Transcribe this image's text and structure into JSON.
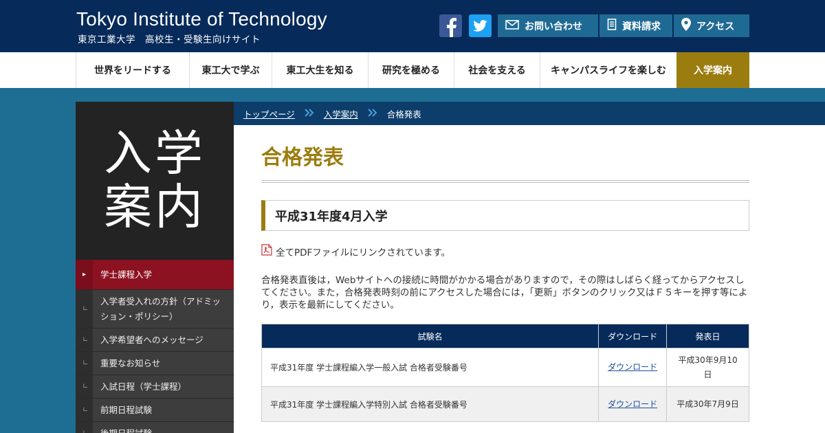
{
  "header": {
    "logo_en": "Tokyo Institute of Technology",
    "logo_ja": "東京工業大学　高校生・受験生向けサイト",
    "buttons": {
      "contact": "お問い合わせ",
      "docs": "資料請求",
      "access": "アクセス"
    },
    "sns": [
      "facebook-icon",
      "twitter-icon"
    ]
  },
  "nav": {
    "items": [
      "世界をリードする",
      "東工大で学ぶ",
      "東工大生を知る",
      "研究を極める",
      "社会を支える",
      "キャンパスライフを楽しむ",
      "入学案内"
    ],
    "active": "入学案内"
  },
  "side": {
    "hero": [
      "入学",
      "案内"
    ],
    "menu": [
      {
        "label": "学士課程入学",
        "current": true
      },
      {
        "label": "入学者受入れの方針（アドミッション・ポリシー）",
        "current": false
      },
      {
        "label": "入学希望者へのメッセージ",
        "current": false
      },
      {
        "label": "重要なお知らせ",
        "current": false
      },
      {
        "label": "入試日程（学士課程）",
        "current": false
      },
      {
        "label": "前期日程試験",
        "current": false
      },
      {
        "label": "後期日程試験",
        "current": false
      }
    ]
  },
  "breadcrumb": [
    "トップページ",
    "入学案内",
    "合格発表"
  ],
  "main": {
    "title": "合格発表",
    "section_title": "平成31年度4月入学",
    "pdf_note": "全てPDFファイルにリンクされています。",
    "paragraph": "合格発表直後は，Webサイトへの接続に時間がかかる場合がありますので，その際はしばらく経ってからアクセスしてください。また，合格発表時刻の前にアクセスした場合には，「更新」ボタンのクリック又はＦ５キーを押す等により，表示を最新にしてください。",
    "table": {
      "headers": [
        "試験名",
        "ダウンロード",
        "発表日"
      ],
      "rows": [
        [
          "平成31年度 学士課程編入学一般入試 合格者受験番号",
          "ダウンロード",
          "平成30年9月10日"
        ],
        [
          "平成31年度 学士課程編入学特別入試 合格者受験番号",
          "ダウンロード",
          "平成30年7月9日"
        ]
      ]
    }
  },
  "colors": {
    "header_bg": "#062a5a",
    "accent_gold": "#9b7d0f",
    "button_blue": "#1f6a94",
    "current_menu": "#8c1121"
  }
}
